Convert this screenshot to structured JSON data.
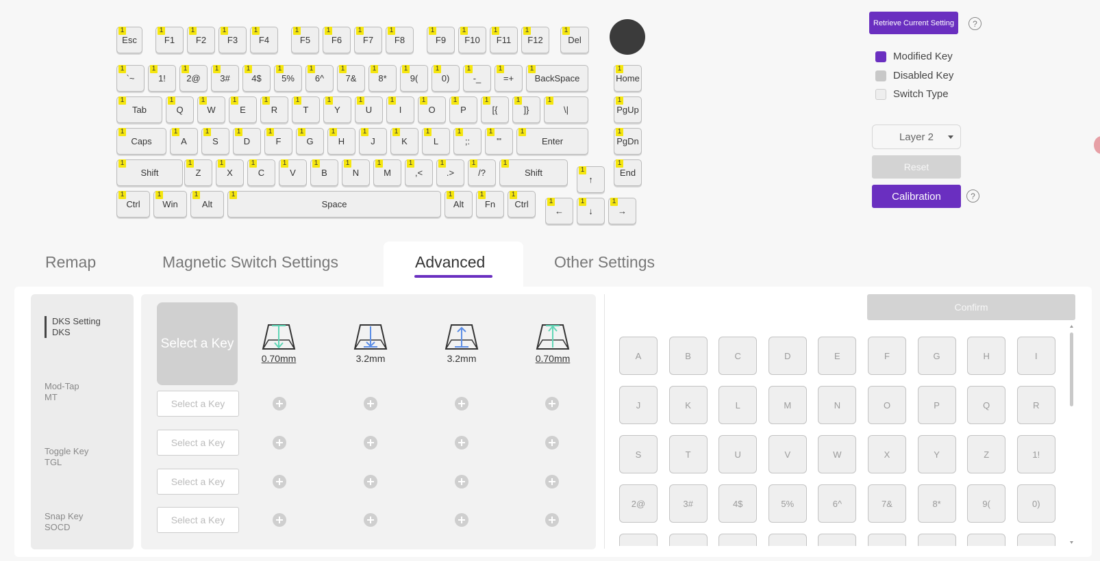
{
  "keyboard": {
    "level": "1",
    "keys": [
      {
        "id": "esc",
        "label": "Esc"
      },
      {
        "id": "f1",
        "label": "F1"
      },
      {
        "id": "f2",
        "label": "F2"
      },
      {
        "id": "f3",
        "label": "F3"
      },
      {
        "id": "f4",
        "label": "F4"
      },
      {
        "id": "f5",
        "label": "F5"
      },
      {
        "id": "f6",
        "label": "F6"
      },
      {
        "id": "f7",
        "label": "F7"
      },
      {
        "id": "f8",
        "label": "F8"
      },
      {
        "id": "f9",
        "label": "F9"
      },
      {
        "id": "f10",
        "label": "F10"
      },
      {
        "id": "f11",
        "label": "F11"
      },
      {
        "id": "f12",
        "label": "F12"
      },
      {
        "id": "del",
        "label": "Del"
      },
      {
        "id": "grave",
        "label": "`~"
      },
      {
        "id": "1",
        "label": "1!"
      },
      {
        "id": "2",
        "label": "2@"
      },
      {
        "id": "3",
        "label": "3#"
      },
      {
        "id": "4",
        "label": "4$"
      },
      {
        "id": "5",
        "label": "5%"
      },
      {
        "id": "6",
        "label": "6^"
      },
      {
        "id": "7",
        "label": "7&"
      },
      {
        "id": "8",
        "label": "8*"
      },
      {
        "id": "9",
        "label": "9("
      },
      {
        "id": "0",
        "label": "0)"
      },
      {
        "id": "minus",
        "label": "-_"
      },
      {
        "id": "equal",
        "label": "=+"
      },
      {
        "id": "backspace",
        "label": "BackSpace"
      },
      {
        "id": "home",
        "label": "Home"
      },
      {
        "id": "tab",
        "label": "Tab"
      },
      {
        "id": "q",
        "label": "Q"
      },
      {
        "id": "w",
        "label": "W"
      },
      {
        "id": "e",
        "label": "E"
      },
      {
        "id": "r",
        "label": "R"
      },
      {
        "id": "t",
        "label": "T"
      },
      {
        "id": "y",
        "label": "Y"
      },
      {
        "id": "u",
        "label": "U"
      },
      {
        "id": "i",
        "label": "I"
      },
      {
        "id": "o",
        "label": "O"
      },
      {
        "id": "p",
        "label": "P"
      },
      {
        "id": "lbracket",
        "label": "[{"
      },
      {
        "id": "rbracket",
        "label": "]}"
      },
      {
        "id": "backslash",
        "label": "\\|"
      },
      {
        "id": "pgup",
        "label": "PgUp"
      },
      {
        "id": "caps",
        "label": "Caps"
      },
      {
        "id": "a",
        "label": "A"
      },
      {
        "id": "s",
        "label": "S"
      },
      {
        "id": "d",
        "label": "D"
      },
      {
        "id": "f",
        "label": "F"
      },
      {
        "id": "g",
        "label": "G"
      },
      {
        "id": "h",
        "label": "H"
      },
      {
        "id": "j",
        "label": "J"
      },
      {
        "id": "k",
        "label": "K"
      },
      {
        "id": "l",
        "label": "L"
      },
      {
        "id": "semicolon",
        "label": ";:"
      },
      {
        "id": "quote",
        "label": "'\""
      },
      {
        "id": "enter",
        "label": "Enter"
      },
      {
        "id": "pgdn",
        "label": "PgDn"
      },
      {
        "id": "lshift",
        "label": "Shift"
      },
      {
        "id": "z",
        "label": "Z"
      },
      {
        "id": "x",
        "label": "X"
      },
      {
        "id": "c",
        "label": "C"
      },
      {
        "id": "v",
        "label": "V"
      },
      {
        "id": "b",
        "label": "B"
      },
      {
        "id": "n",
        "label": "N"
      },
      {
        "id": "m",
        "label": "M"
      },
      {
        "id": "comma",
        "label": ",<"
      },
      {
        "id": "period",
        "label": ".>"
      },
      {
        "id": "slash",
        "label": "/?"
      },
      {
        "id": "rshift",
        "label": "Shift"
      },
      {
        "id": "up",
        "label": "↑"
      },
      {
        "id": "end",
        "label": "End"
      },
      {
        "id": "lctrl",
        "label": "Ctrl"
      },
      {
        "id": "win",
        "label": "Win"
      },
      {
        "id": "lalt",
        "label": "Alt"
      },
      {
        "id": "space",
        "label": "Space"
      },
      {
        "id": "ralt",
        "label": "Alt"
      },
      {
        "id": "fn",
        "label": "Fn"
      },
      {
        "id": "rctrl",
        "label": "Ctrl"
      },
      {
        "id": "left",
        "label": "←"
      },
      {
        "id": "down",
        "label": "↓"
      },
      {
        "id": "right",
        "label": "→"
      }
    ]
  },
  "controls": {
    "retrieve_label": "Retrieve Current Setting",
    "help": "?",
    "legend": [
      {
        "label": "Modified Key",
        "color": "#6a2fc0"
      },
      {
        "label": "Disabled Key",
        "color": "#c8c8c8"
      },
      {
        "label": "Switch Type",
        "color": "#eeeeee"
      }
    ],
    "layer_selected": "Layer 2",
    "reset_label": "Reset",
    "calibration_label": "Calibration"
  },
  "tabs": [
    {
      "label": "Remap",
      "active": false
    },
    {
      "label": "Magnetic Switch Settings",
      "active": false
    },
    {
      "label": "Advanced",
      "active": true
    },
    {
      "label": "Other Settings",
      "active": false
    }
  ],
  "sidebar": [
    {
      "title": "DKS Setting",
      "sub": "DKS",
      "active": true
    },
    {
      "title": "Mod-Tap",
      "sub": "MT",
      "active": false
    },
    {
      "title": "Toggle Key",
      "sub": "TGL",
      "active": false
    },
    {
      "title": "Snap Key",
      "sub": "SOCD",
      "active": false
    }
  ],
  "dks": {
    "select_main": "Select a Key",
    "select_row": "Select a Key",
    "travels": [
      {
        "value": "0.70mm",
        "icon": "press-start-icon"
      },
      {
        "value": "3.2mm",
        "icon": "bottom-out-icon"
      },
      {
        "value": "3.2mm",
        "icon": "release-start-icon"
      },
      {
        "value": "0.70mm",
        "icon": "release-end-icon"
      }
    ]
  },
  "picker": {
    "confirm_label": "Confirm",
    "keys": [
      "A",
      "B",
      "C",
      "D",
      "E",
      "F",
      "G",
      "H",
      "I",
      "J",
      "K",
      "L",
      "M",
      "N",
      "O",
      "P",
      "Q",
      "R",
      "S",
      "T",
      "U",
      "V",
      "W",
      "X",
      "Y",
      "Z",
      "1!",
      "2@",
      "3#",
      "4$",
      "5%",
      "6^",
      "7&",
      "8*",
      "9(",
      "0)",
      "",
      "",
      "",
      "",
      "",
      "",
      "",
      "",
      ""
    ]
  },
  "colors": {
    "accent": "#6a2fc0",
    "level_badge": "#f5e60f",
    "icon_arrow": "#5fd6b6",
    "icon_arrow_down": "#5b8de6"
  }
}
